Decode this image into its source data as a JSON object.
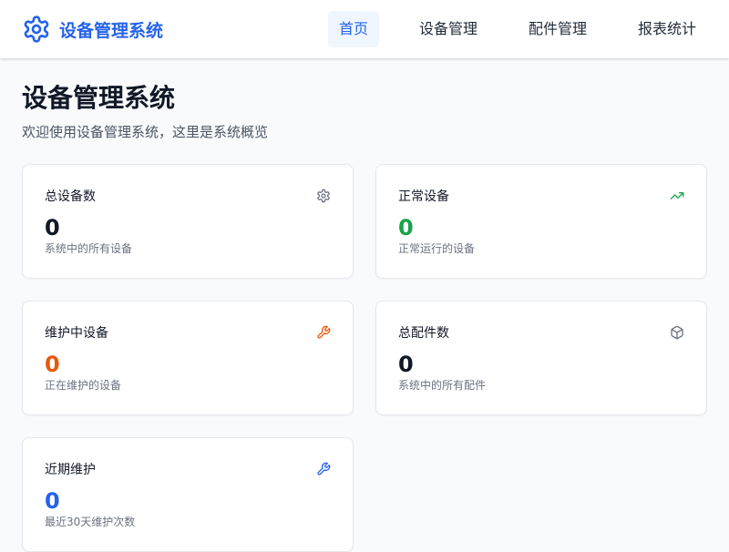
{
  "app": {
    "brand_name": "设备管理系统",
    "brand_icon": "gear-icon",
    "accent_color": "#2563eb"
  },
  "nav": {
    "items": [
      {
        "label": "首页",
        "active": true
      },
      {
        "label": "设备管理",
        "active": false
      },
      {
        "label": "配件管理",
        "active": false
      },
      {
        "label": "报表统计",
        "active": false
      }
    ]
  },
  "page": {
    "title": "设备管理系统",
    "subtitle": "欢迎使用设备管理系统，这里是系统概览"
  },
  "cards": [
    {
      "title": "总设备数",
      "value": "0",
      "desc": "系统中的所有设备",
      "icon": "gear-icon",
      "value_color": "#111827",
      "icon_color": "#6b7280"
    },
    {
      "title": "正常设备",
      "value": "0",
      "desc": "正常运行的设备",
      "icon": "trending-up-icon",
      "value_color": "#16a34a",
      "icon_color": "#16a34a"
    },
    {
      "title": "维护中设备",
      "value": "0",
      "desc": "正在维护的设备",
      "icon": "wrench-icon",
      "value_color": "#ea580c",
      "icon_color": "#ea580c"
    },
    {
      "title": "总配件数",
      "value": "0",
      "desc": "系统中的所有配件",
      "icon": "package-icon",
      "value_color": "#111827",
      "icon_color": "#6b7280"
    },
    {
      "title": "近期维护",
      "value": "0",
      "desc": "最近30天维护次数",
      "icon": "wrench-icon",
      "value_color": "#2563eb",
      "icon_color": "#2563eb"
    }
  ]
}
